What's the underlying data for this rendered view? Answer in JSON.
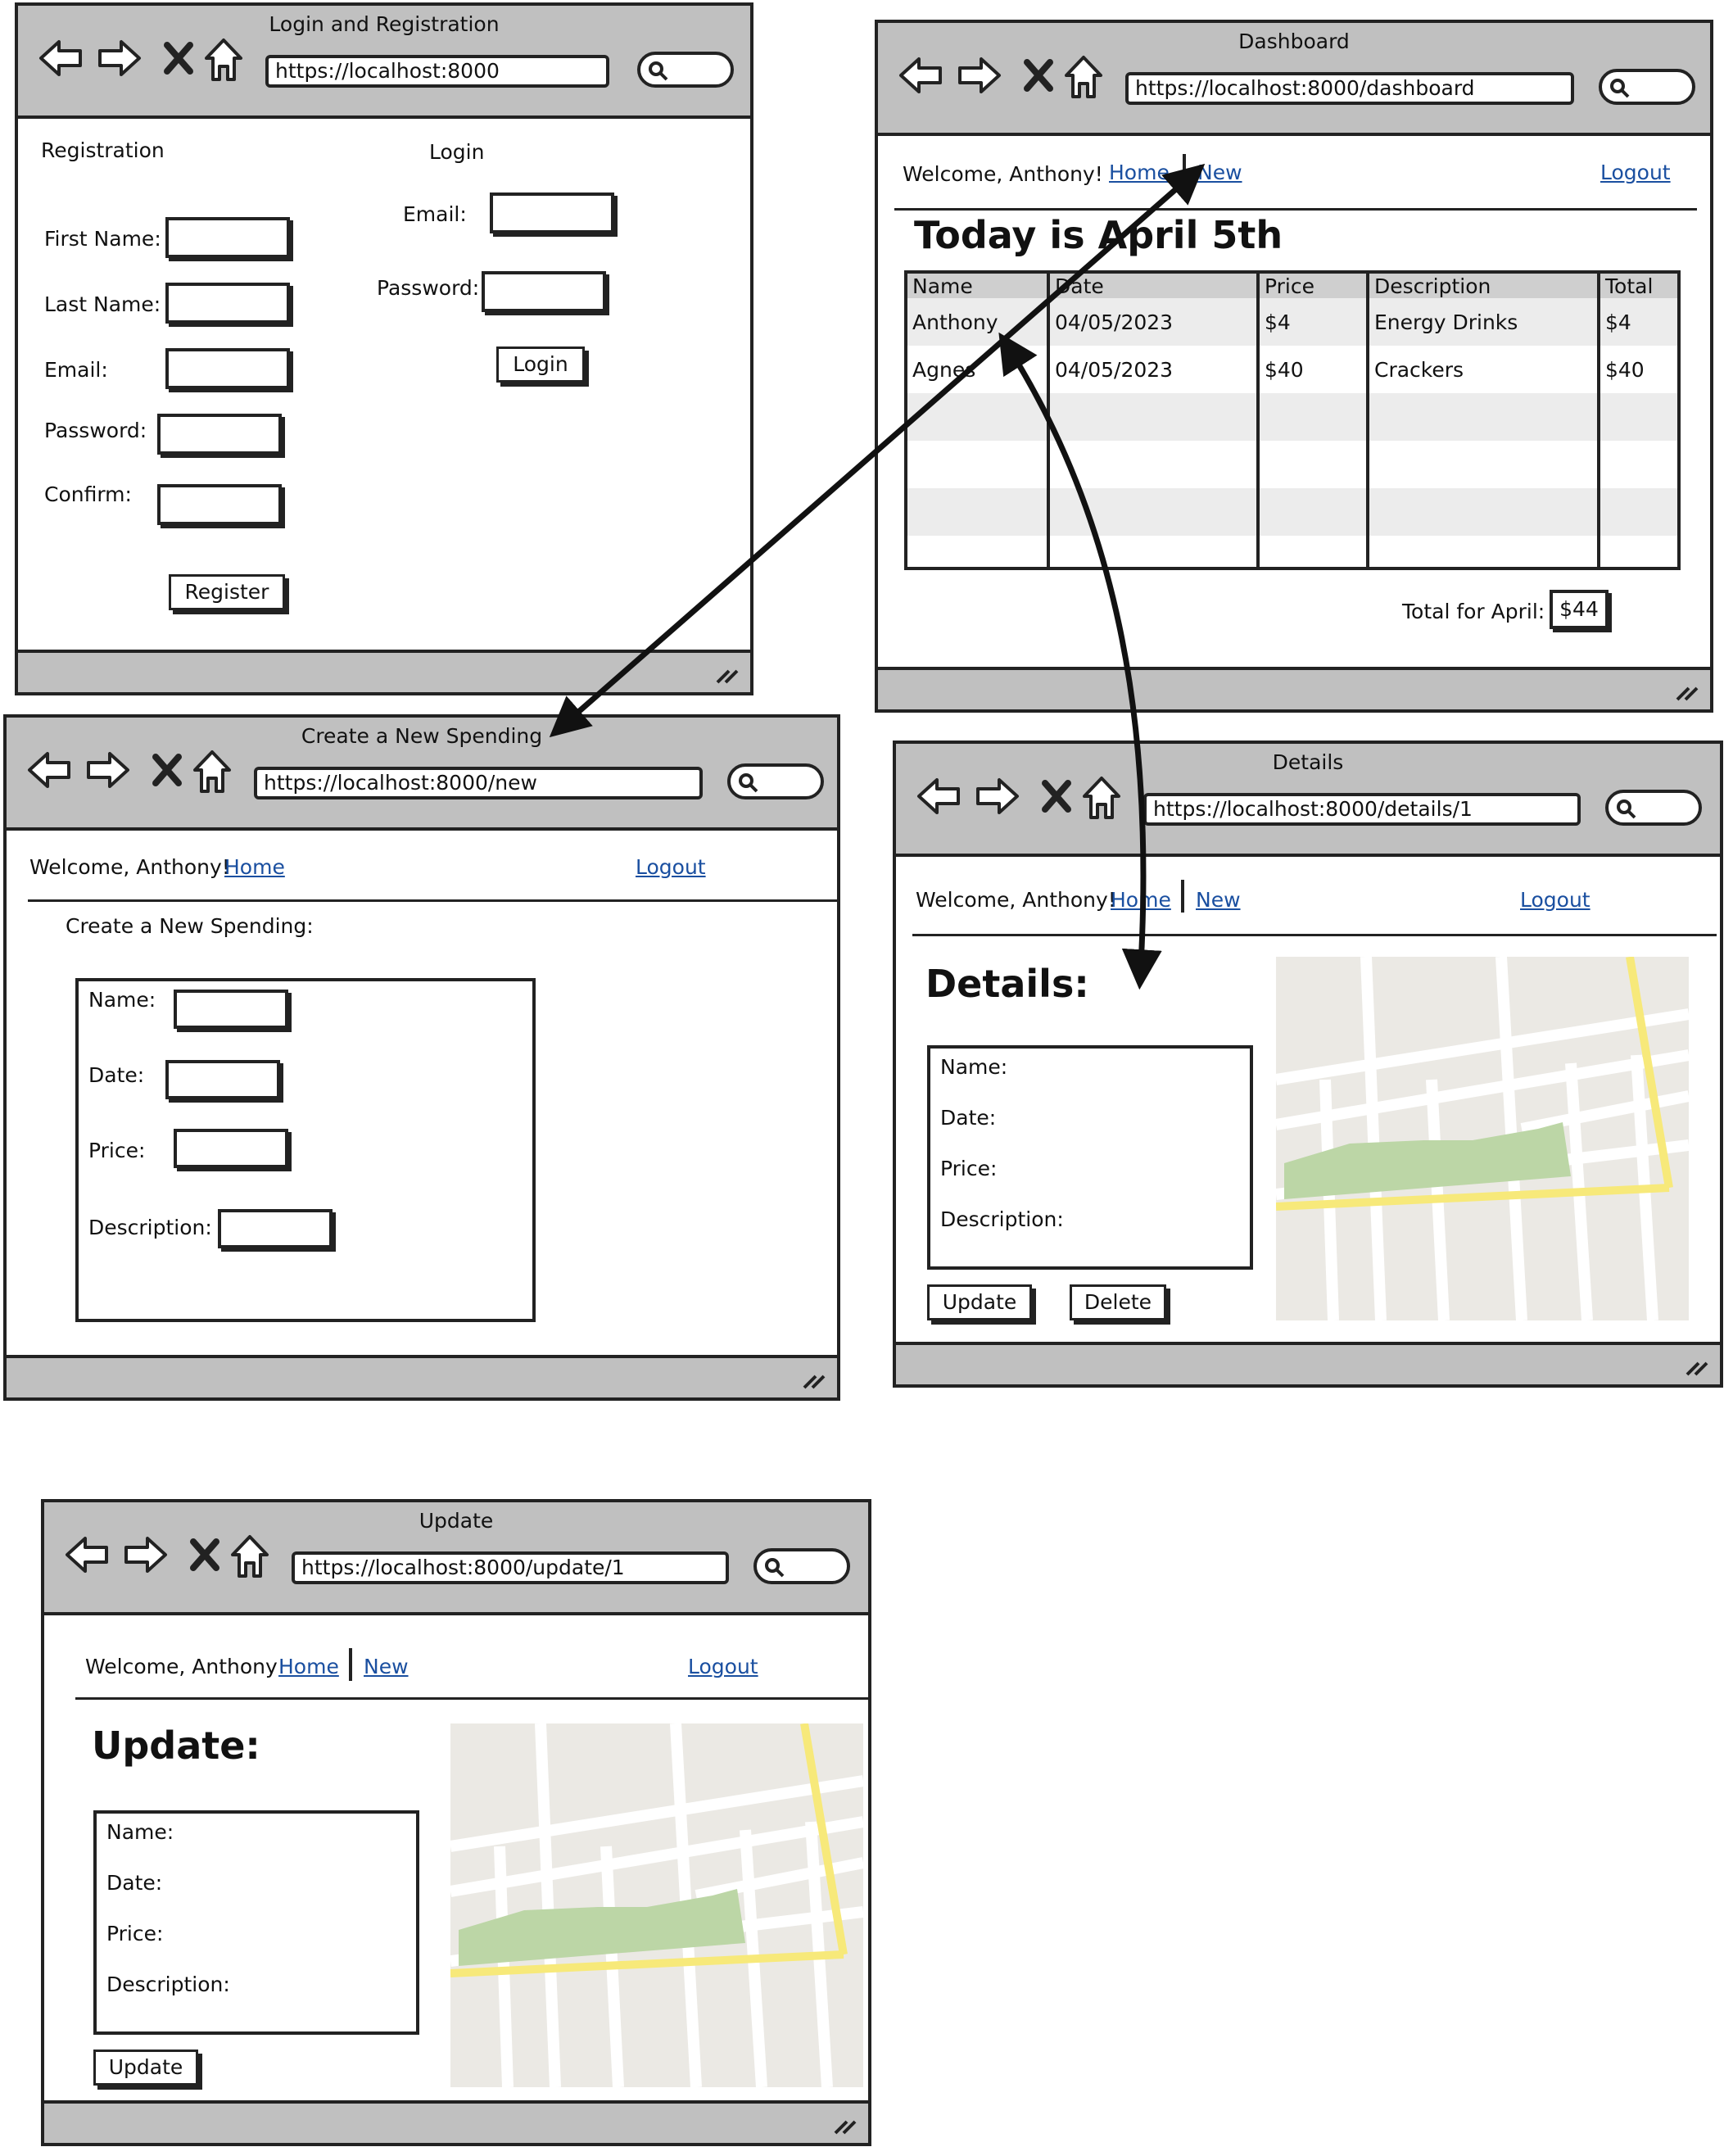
{
  "windows": {
    "login": {
      "title": "Login and Registration",
      "url": "https://localhost:8000",
      "registration": {
        "heading": "Registration",
        "first_name": "First Name:",
        "last_name": "Last Name:",
        "email": "Email:",
        "password": "Password:",
        "confirm": "Confirm:",
        "register_button": "Register"
      },
      "login_form": {
        "heading": "Login",
        "email": "Email:",
        "password": "Password:",
        "login_button": "Login"
      }
    },
    "dashboard": {
      "title": "Dashboard",
      "url": "https://localhost:8000/dashboard",
      "welcome": "Welcome, Anthony!",
      "nav_home": "Home",
      "nav_new": "New",
      "nav_logout": "Logout",
      "heading": "Today is April 5th",
      "table": {
        "headers": [
          "Name",
          "Date",
          "Price",
          "Description",
          "Total"
        ],
        "rows": [
          [
            "Anthony",
            "04/05/2023",
            "$4",
            "Energy Drinks",
            "$4"
          ],
          [
            "Agnes",
            "04/05/2023",
            "$40",
            "Crackers",
            "$40"
          ]
        ]
      },
      "total_label": "Total for April:",
      "total_value": "$44"
    },
    "new": {
      "title": "Create a New Spending",
      "url": "https://localhost:8000/new",
      "welcome": "Welcome, Anthony!",
      "nav_home": "Home",
      "nav_logout": "Logout",
      "form_heading": "Create a New Spending:",
      "name": "Name:",
      "date": "Date:",
      "price": "Price:",
      "description": "Description:"
    },
    "details": {
      "title": "Details",
      "url": "https://localhost:8000/details/1",
      "welcome": "Welcome, Anthony!",
      "nav_home": "Home",
      "nav_new": "New",
      "nav_logout": "Logout",
      "heading": "Details:",
      "name": "Name:",
      "date": "Date:",
      "price": "Price:",
      "description": "Description:",
      "update_button": "Update",
      "delete_button": "Delete"
    },
    "update": {
      "title": "Update",
      "url": "https://localhost:8000/update/1",
      "welcome": "Welcome, Anthony!",
      "nav_home": "Home",
      "nav_new": "New",
      "nav_logout": "Logout",
      "heading": "Update:",
      "name": "Name:",
      "date": "Date:",
      "price": "Price:",
      "description": "Description:",
      "update_button": "Update"
    }
  },
  "colors": {
    "chrome": "#c0c0c0",
    "link": "#1a4fa0",
    "map_block": "#ebe9e4",
    "map_road_yellow": "#f7e97a",
    "map_park": "#bcd6a6"
  }
}
